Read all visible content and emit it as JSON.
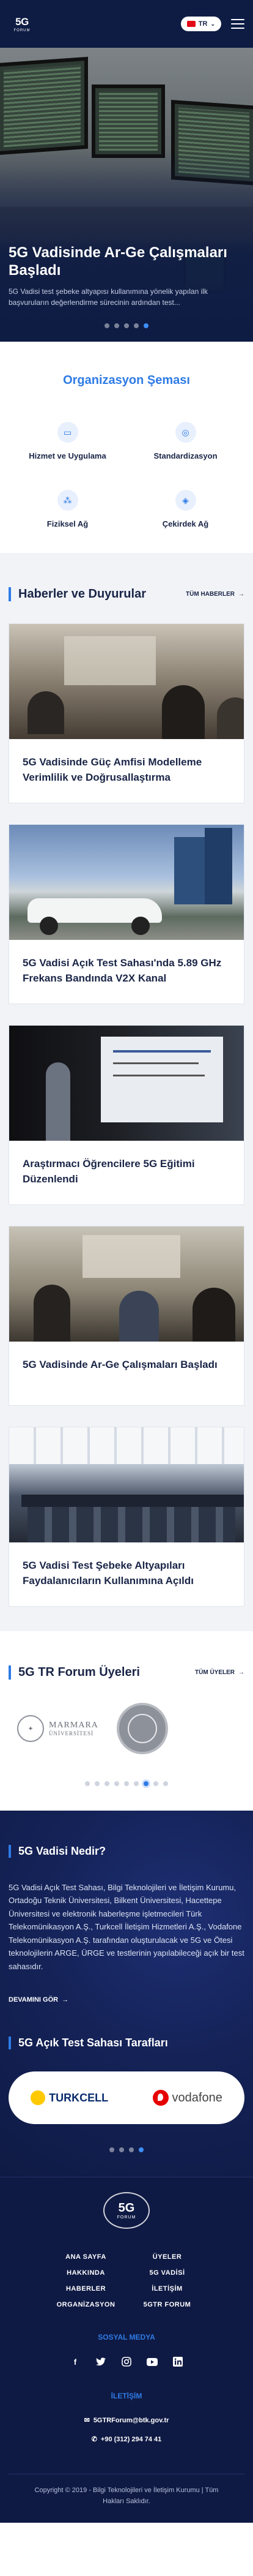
{
  "header": {
    "logo_text": "5G",
    "logo_sub": "FORUM",
    "language": "TR",
    "lang_chevron": "⌄"
  },
  "hero": {
    "title": "5G Vadisinde Ar-Ge Çalışmaları Başladı",
    "description": "5G Vadisi test şebeke altyapısı kullanımına yönelik yapılan ilk başvuruların değerlendirme sürecinin ardından test...",
    "slide_count": 5,
    "active_slide": 4
  },
  "organization": {
    "title": "Organizasyon Şeması",
    "items": [
      {
        "label": "Hizmet ve Uygulama",
        "icon": "screen-icon"
      },
      {
        "label": "Standardizasyon",
        "icon": "compass-icon"
      },
      {
        "label": "Fiziksel Ağ",
        "icon": "network-icon"
      },
      {
        "label": "Çekirdek Ağ",
        "icon": "core-icon"
      }
    ]
  },
  "news": {
    "title": "Haberler ve Duyurular",
    "all_label": "TÜM HABERLER",
    "arrow": "→",
    "items": [
      {
        "title": "5G Vadisinde Güç Amfisi Modelleme Verimlilik ve Doğrusallaştırma"
      },
      {
        "title": "5G Vadisi Açık Test Sahası'nda 5.89 GHz Frekans Bandında V2X Kanal"
      },
      {
        "title": "Araştırmacı Öğrencilere 5G Eğitimi Düzenlendi"
      },
      {
        "title": "5G Vadisinde Ar-Ge Çalışmaları Başladı"
      },
      {
        "title": "5G Vadisi Test Şebeke Altyapıları Faydalanıcıların Kullanımına Açıldı"
      }
    ]
  },
  "forum": {
    "title": "5G TR Forum Üyeleri",
    "all_label": "TÜM ÜYELER",
    "arrow": "→",
    "marmara_name": "MARMARA",
    "marmara_sub": "ÜNİVERSİTESİ",
    "slide_count": 9,
    "active_slide": 6
  },
  "valley": {
    "title": "5G Vadisi Nedir?",
    "text": "5G Vadisi Açık Test Sahası, Bilgi Teknolojileri ve İletişim Kurumu, Ortadoğu Teknik Üniversitesi, Bilkent Üniversitesi, Hacettepe Üniversitesi ve elektronik haberleşme işletmecileri Türk Telekomünikasyon A.Ş., Turkcell İletişim Hizmetleri A.Ş., Vodafone Telekomünikasyon A.Ş. tarafından oluşturulacak ve 5G ve Ötesi teknolojilerin ARGE, ÜRGE ve testlerinin yapılabileceği açık bir test sahasıdır.",
    "more_label": "DEVAMINI GÖR",
    "arrow": "→",
    "partners_title": "5G Açık Test Sahası Tarafları",
    "partner_1": "TURKCELL",
    "partner_2": "vodafone",
    "slide_count": 4,
    "active_slide": 3
  },
  "footer": {
    "logo_text": "5G",
    "logo_sub": "FORUM",
    "nav": [
      "ANA SAYFA",
      "ÜYELER",
      "HAKKINDA",
      "5G VADİSİ",
      "HABERLER",
      "İLETİŞİM",
      "ORGANİZASYON",
      "5GTR FORUM"
    ],
    "social_title": "SOSYAL MEDYA",
    "social_icons": [
      "facebook-icon",
      "twitter-icon",
      "instagram-icon",
      "youtube-icon",
      "linkedin-icon"
    ],
    "contact_title": "İLETİŞİM",
    "email": "5GTRForum@btk.gov.tr",
    "phone": "+90 (312) 294 74 41",
    "copyright": "Copyright © 2019 - Bilgi Teknolojileri ve İletişim Kurumu | Tüm Hakları Saklıdır."
  },
  "colors": {
    "navy": "#0e1c44",
    "accent": "#2e7be6",
    "section_bg": "#f1f3f7"
  }
}
